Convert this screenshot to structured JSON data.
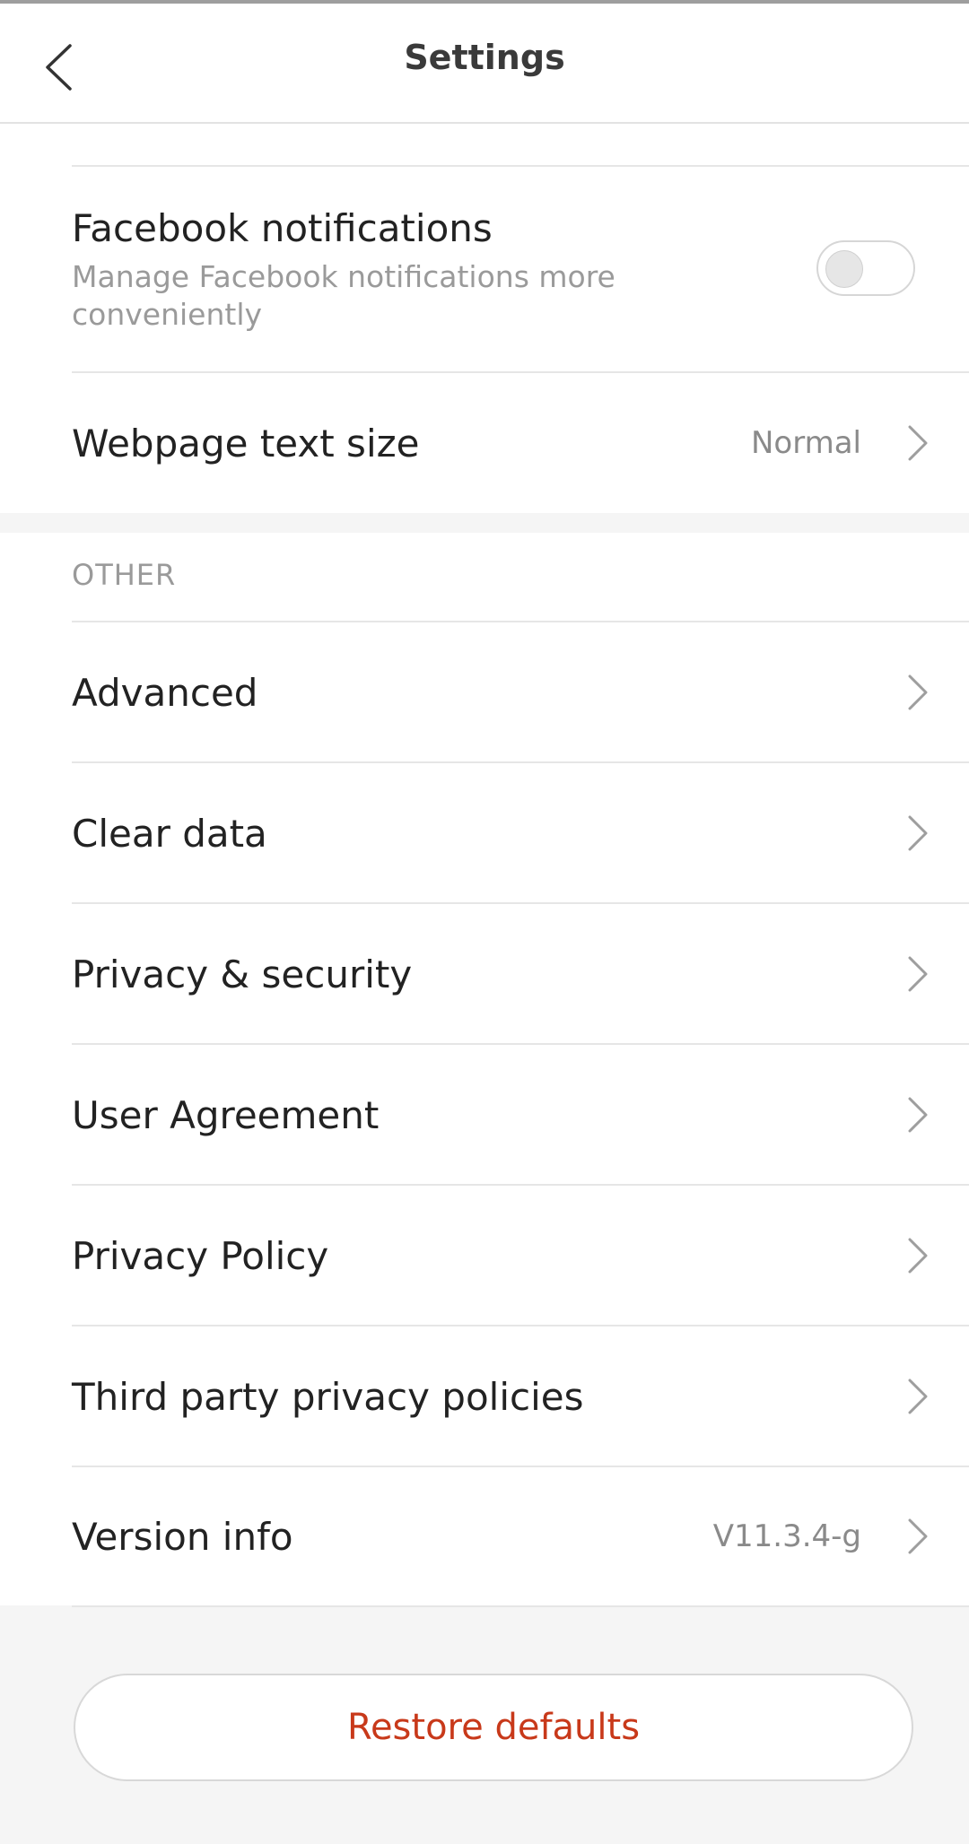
{
  "header": {
    "title": "Settings",
    "back_icon": "chevron-left-icon"
  },
  "general": {
    "facebook": {
      "title": "Facebook notifications",
      "subtitle": "Manage Facebook notifications more conveniently",
      "toggle_on": false
    },
    "text_size": {
      "label": "Webpage text size",
      "value": "Normal"
    }
  },
  "other": {
    "section_label": "OTHER",
    "items": [
      {
        "label": "Advanced"
      },
      {
        "label": "Clear data"
      },
      {
        "label": "Privacy & security"
      },
      {
        "label": "User Agreement"
      },
      {
        "label": "Privacy Policy"
      },
      {
        "label": "Third party privacy policies"
      },
      {
        "label": "Version info",
        "value": "V11.3.4-g"
      }
    ]
  },
  "footer": {
    "restore_label": "Restore defaults"
  },
  "colors": {
    "accent": "#c8391a",
    "chevron": "#9e9e9e",
    "background": "#f5f5f5"
  }
}
